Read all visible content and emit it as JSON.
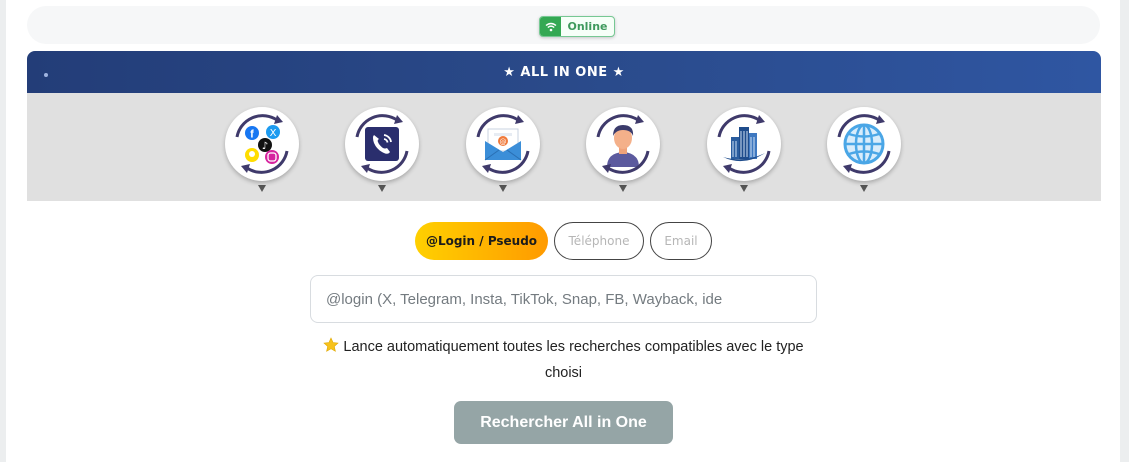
{
  "status": {
    "label": "Online",
    "icon": "wifi-icon",
    "color": "#34a853"
  },
  "all_in_one": {
    "title": "★ ALL IN ONE ★",
    "header_color": "#2a4a8a",
    "categories": [
      {
        "id": "social",
        "icon": "social-networks-icon"
      },
      {
        "id": "phone",
        "icon": "phone-icon"
      },
      {
        "id": "email",
        "icon": "email-icon"
      },
      {
        "id": "person",
        "icon": "person-icon"
      },
      {
        "id": "company",
        "icon": "building-icon"
      },
      {
        "id": "web",
        "icon": "globe-icon"
      }
    ]
  },
  "search_tabs": [
    {
      "label": "@Login / Pseudo",
      "active": true
    },
    {
      "label": "Téléphone",
      "active": false
    },
    {
      "label": "Email",
      "active": false
    }
  ],
  "search": {
    "placeholder": "@login (X, Telegram, Insta, TikTok, Snap, FB, Wayback, ide",
    "value": ""
  },
  "hint": {
    "icon": "star-icon",
    "text": "Lance automatiquement toutes les recherches compatibles avec le type choisi"
  },
  "search_button": {
    "label": "Rechercher All in One",
    "color": "#95a5a6"
  }
}
